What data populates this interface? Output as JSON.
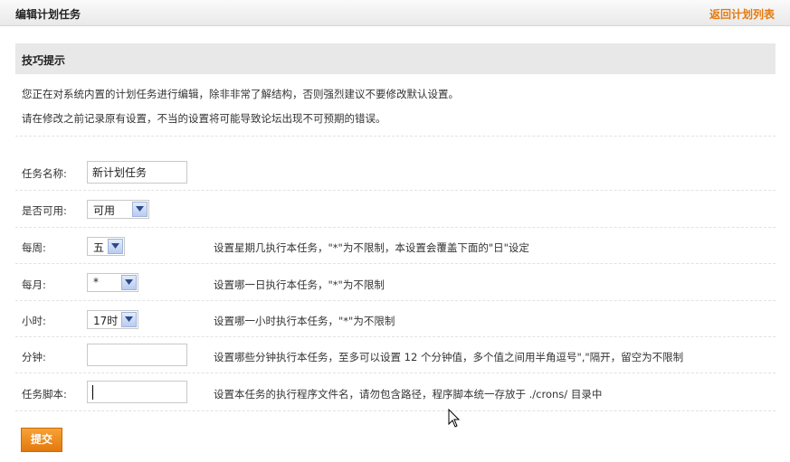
{
  "header": {
    "title": "编辑计划任务",
    "back_link": "返回计划列表"
  },
  "tips": {
    "title": "技巧提示",
    "lines": [
      "您正在对系统内置的计划任务进行编辑，除非非常了解结构，否则强烈建议不要修改默认设置。",
      "请在修改之前记录原有设置，不当的设置将可能导致论坛出现不可预期的错误。"
    ]
  },
  "form": {
    "name": {
      "label": "任务名称:",
      "value": "新计划任务"
    },
    "enabled": {
      "label": "是否可用:",
      "value": "可用"
    },
    "weekday": {
      "label": "每周:",
      "value": "五",
      "hint": "设置星期几执行本任务，\"*\"为不限制，本设置会覆盖下面的\"日\"设定"
    },
    "day": {
      "label": "每月:",
      "value": "*",
      "hint": "设置哪一日执行本任务，\"*\"为不限制"
    },
    "hour": {
      "label": "小时:",
      "value": "17时",
      "hint": "设置哪一小时执行本任务，\"*\"为不限制"
    },
    "minute": {
      "label": "分钟:",
      "value": "",
      "hint": "设置哪些分钟执行本任务，至多可以设置 12 个分钟值，多个值之间用半角逗号\",\"隔开，留空为不限制"
    },
    "script": {
      "label": "任务脚本:",
      "value": "",
      "hint": "设置本任务的执行程序文件名，请勿包含路径，程序脚本统一存放于 ./crons/ 目录中"
    }
  },
  "submit_label": "提交",
  "colors": {
    "accent": "#e47b12",
    "submit_bg": "#f08c1d",
    "tips_bg": "#e8e8e8"
  },
  "icons": {
    "select_arrow": "chevron-down-icon",
    "pointer": "mouse-cursor-icon"
  }
}
